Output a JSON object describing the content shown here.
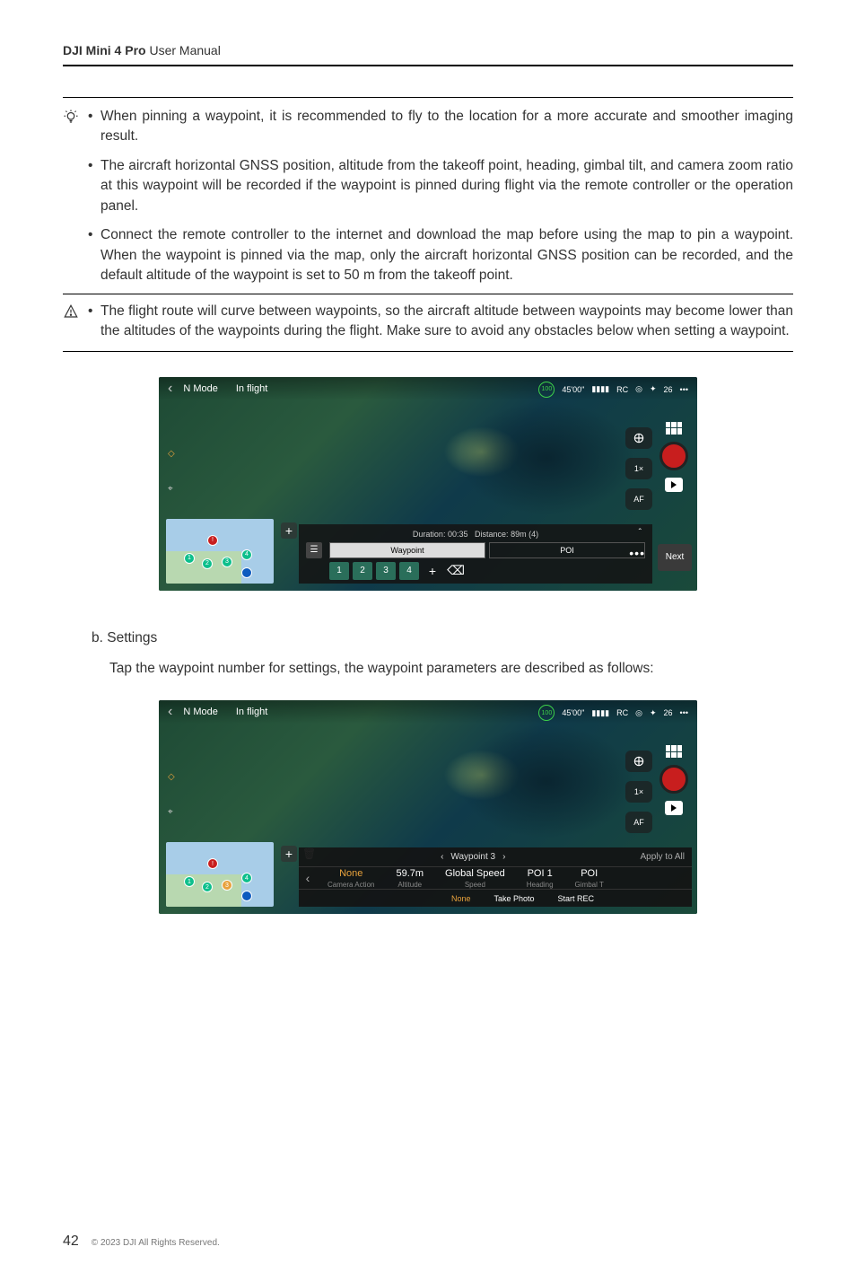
{
  "header": {
    "product": "DJI Mini 4 Pro",
    "title_rest": " User Manual"
  },
  "tips": [
    "When pinning a waypoint, it is recommended to fly to the location for a more accurate and smoother imaging result.",
    "The aircraft horizontal GNSS position, altitude from the takeoff point, heading, gimbal tilt, and camera zoom ratio at this waypoint will be recorded if the waypoint is pinned during flight via the remote controller or the operation panel.",
    "Connect the remote controller to the internet and download the map before using the map to pin a waypoint. When the waypoint is pinned via the map, only the aircraft horizontal GNSS position can be recorded, and the default altitude of the waypoint is set to 50 m from the takeoff point."
  ],
  "warning": "The flight route will curve between waypoints, so the aircraft altitude between waypoints may become lower than the altitudes of the waypoints during the flight. Make sure to avoid any obstacles below when setting a waypoint.",
  "screenshot1": {
    "mode": "N Mode",
    "status": "In flight",
    "battery_pct": "100",
    "time": "45'00\"",
    "rc": "RC",
    "sats": "26",
    "sidebar": {
      "zoom": "1×",
      "af": "AF"
    },
    "strip": {
      "duration_label": "Duration:",
      "duration_value": "00:35",
      "distance_label": "Distance:",
      "distance_value": "89m (4)",
      "tab_waypoint": "Waypoint",
      "tab_poi": "POI",
      "nums": [
        "1",
        "2",
        "3",
        "4"
      ]
    },
    "next": "Next"
  },
  "section_b": {
    "label": "b.  Settings",
    "desc": "Tap the waypoint number for settings, the waypoint parameters are described as follows:"
  },
  "screenshot2": {
    "mode": "N Mode",
    "status": "In flight",
    "battery_pct": "100",
    "time": "45'00\"",
    "rc": "RC",
    "sats": "26",
    "sidebar": {
      "zoom": "1×",
      "af": "AF"
    },
    "settings": {
      "wp_label": "Waypoint 3",
      "apply": "Apply to All",
      "params": [
        {
          "value": "None",
          "label": "Camera Action",
          "none": true
        },
        {
          "value": "59.7m",
          "label": "Altitude"
        },
        {
          "value": "Global Speed",
          "label": "Speed"
        },
        {
          "value": "POI 1",
          "label": "Heading"
        },
        {
          "value": "POI",
          "label": "Gimbal T"
        }
      ],
      "row2": [
        {
          "value": "None",
          "none": true
        },
        {
          "value": "Take Photo"
        },
        {
          "value": "Start REC"
        }
      ]
    }
  },
  "footer": {
    "page": "42",
    "copyright": "© 2023 DJI All Rights Reserved."
  }
}
